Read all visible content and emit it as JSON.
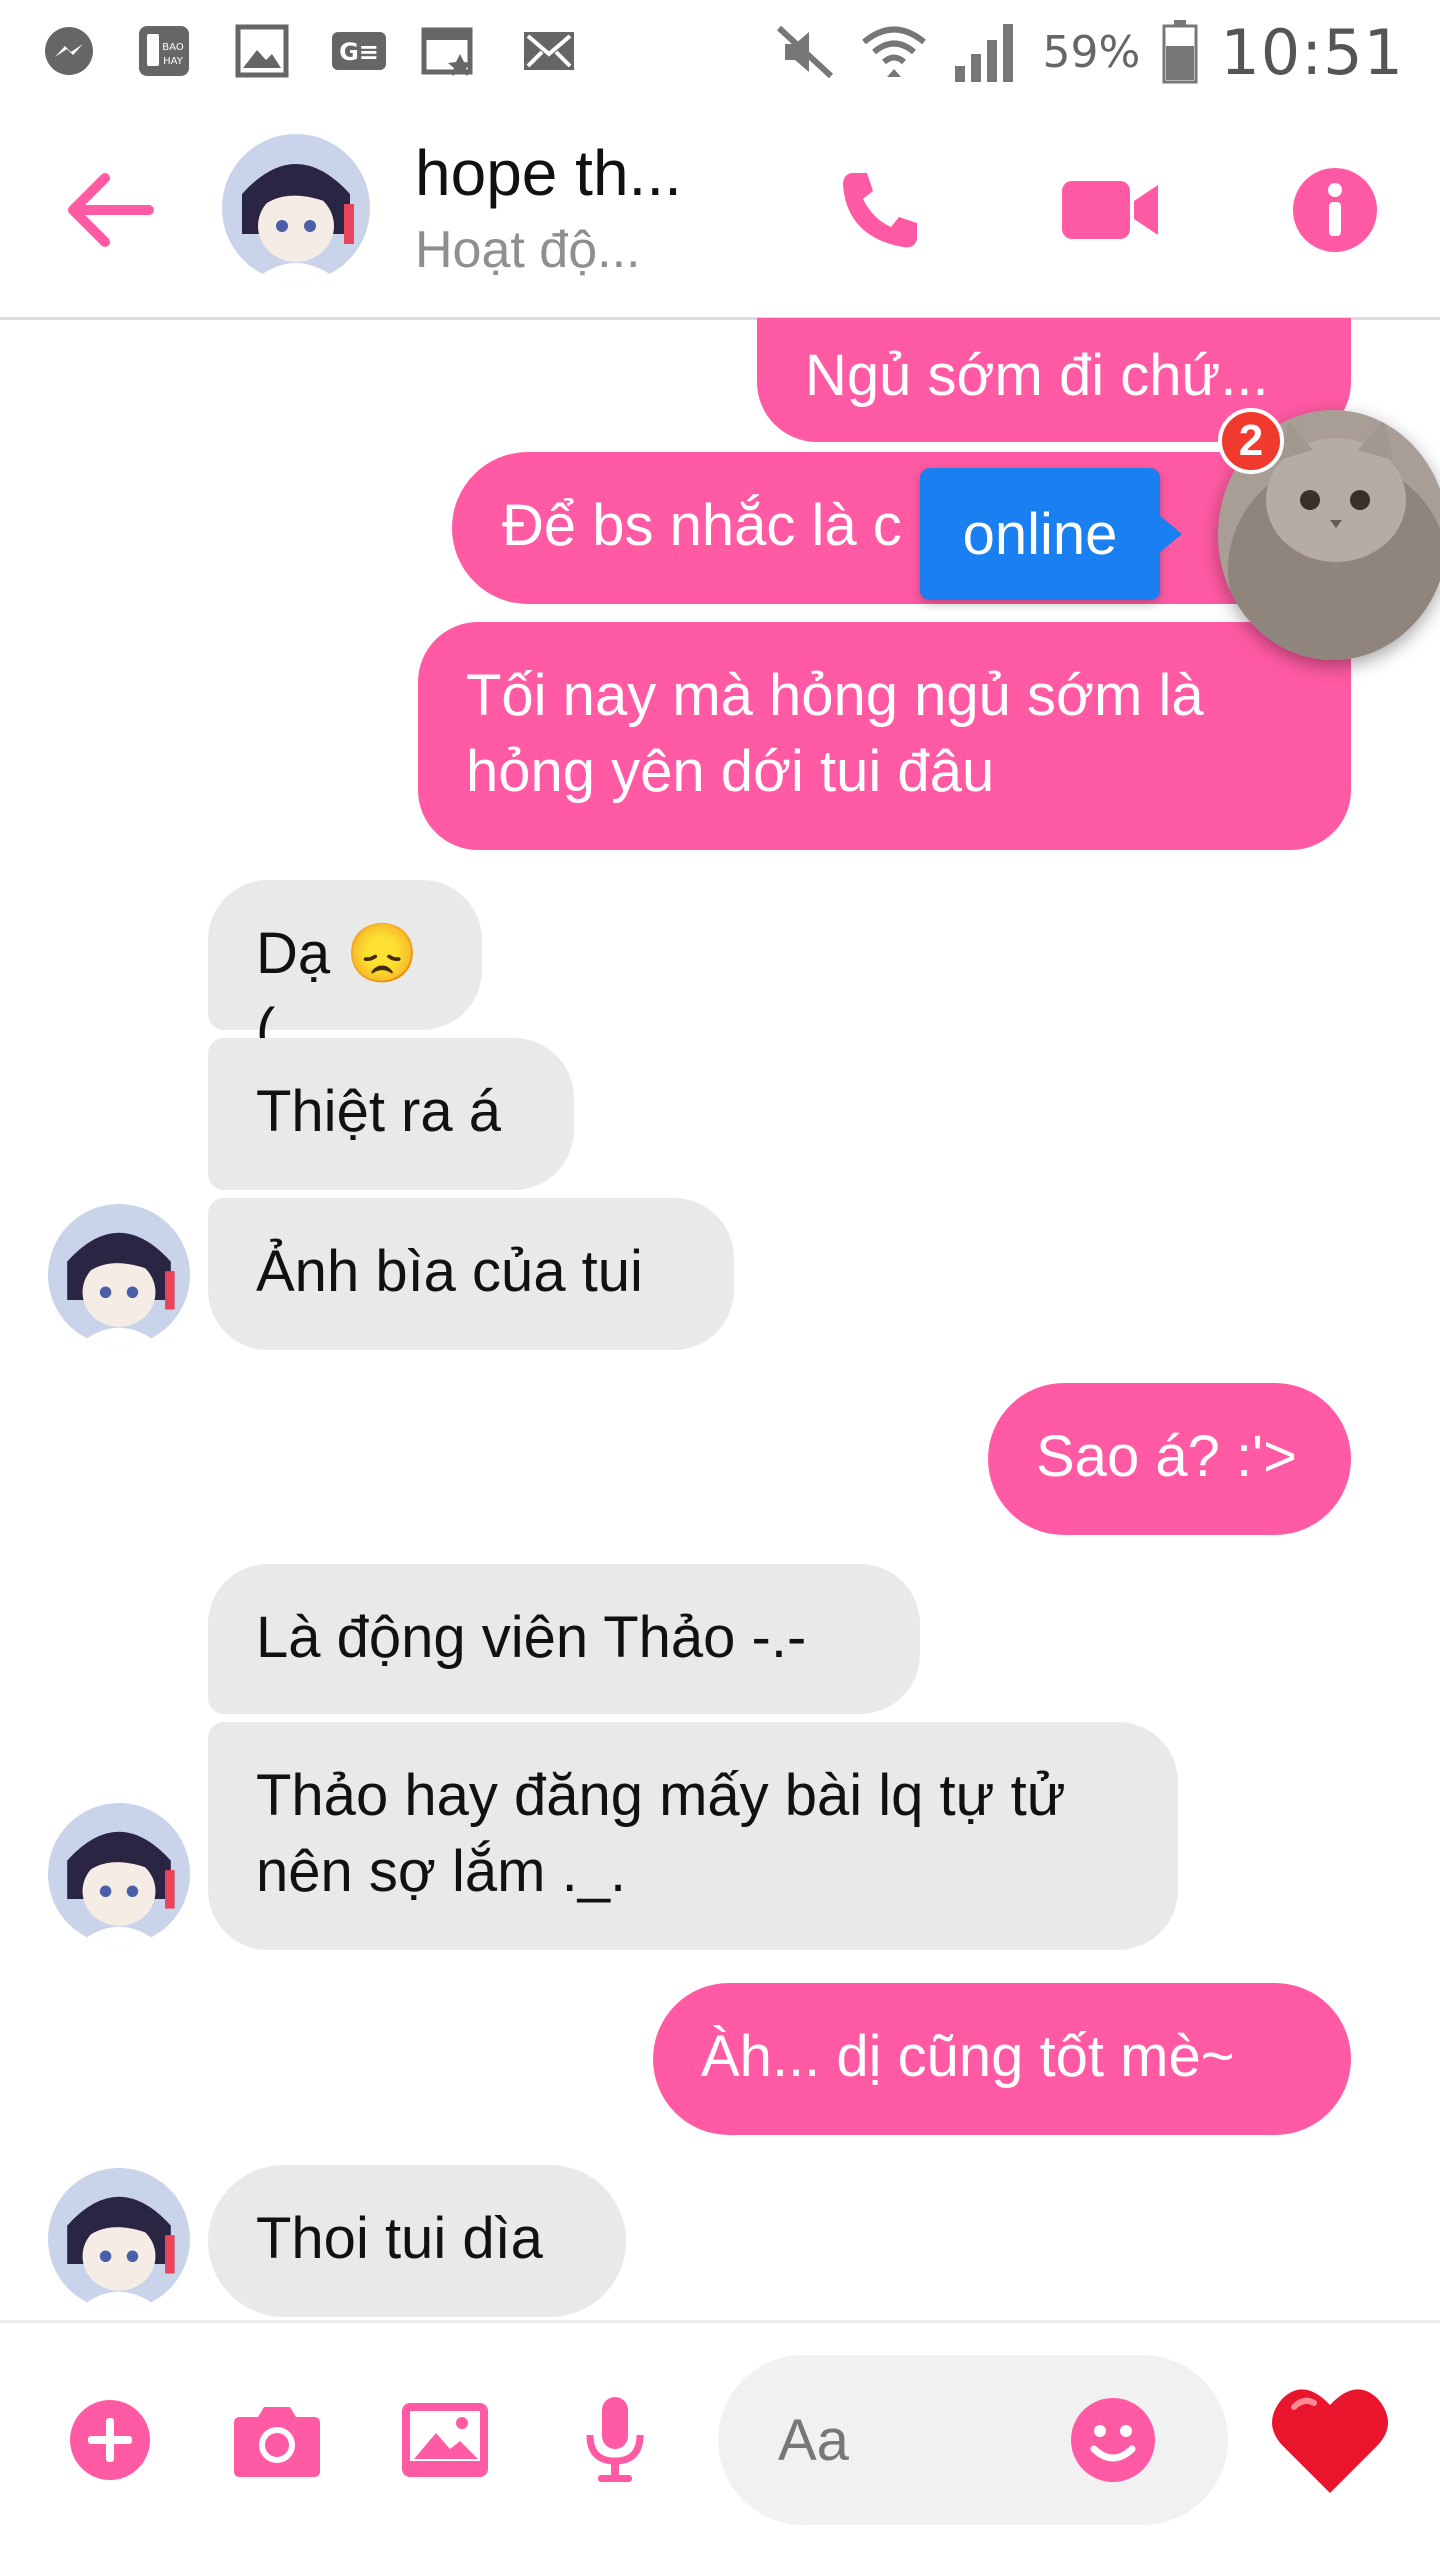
{
  "status_bar": {
    "battery_percent": "59%",
    "time": "10:51",
    "icons": [
      "messenger-icon",
      "baohay-icon",
      "gallery-icon",
      "ge-icon",
      "calendar-star-icon",
      "mail-icon",
      "mute-icon",
      "wifi-icon",
      "signal-icon",
      "battery-icon"
    ]
  },
  "header": {
    "contact_name": "hope th...",
    "contact_status": "Hoạt độ...",
    "accent_color": "#ff5aa3"
  },
  "chat_head": {
    "badge_count": "2",
    "tooltip": "online"
  },
  "messages": [
    {
      "dir": "out",
      "text": "Ngủ sớm đi chứ..."
    },
    {
      "dir": "out",
      "text": "Để bs nhắc là c"
    },
    {
      "dir": "out",
      "text": "Tối nay mà hỏng ngủ sớm là hỏng yên dới tui đâu"
    },
    {
      "dir": "in",
      "text": "Dạ 😞("
    },
    {
      "dir": "in",
      "text": "Thiệt ra á"
    },
    {
      "dir": "in",
      "text": "Ảnh bìa của tui"
    },
    {
      "dir": "out",
      "text": "Sao á? :'>"
    },
    {
      "dir": "in",
      "text": "Là động viên Thảo -.-"
    },
    {
      "dir": "in",
      "text": "Thảo hay đăng mấy bài lq tự tử nên sợ lắm ._."
    },
    {
      "dir": "out",
      "text": "Àh... dị cũng tốt mè~"
    },
    {
      "dir": "in",
      "text": "Thoi tui dìa"
    }
  ],
  "composer": {
    "placeholder": "Aa"
  }
}
